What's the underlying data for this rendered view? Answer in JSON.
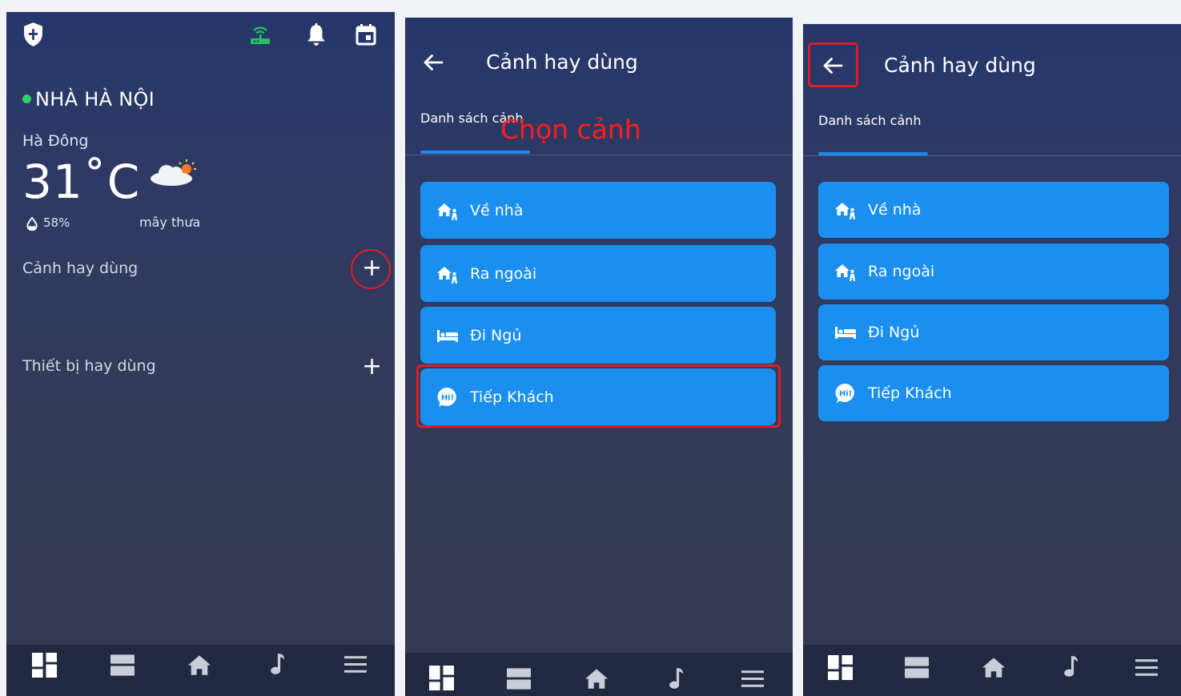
{
  "screen1": {
    "home_name": "NHÀ HÀ NỘI",
    "district": "Hà Đông",
    "temperature": "31˚C",
    "humidity": "58%",
    "weather_desc": "mây thưa",
    "scenes_label": "Cảnh hay dùng",
    "devices_label": "Thiết bị hay dùng",
    "add_symbol": "+",
    "icons": [
      "shield-icon",
      "router-icon",
      "bell-icon",
      "calendar-icon",
      "cloud-sun-icon",
      "droplet-icon",
      "plus-icon"
    ]
  },
  "screen2": {
    "title": "Cảnh hay dùng",
    "tab": "Danh sách cảnh",
    "annotation": "Chọn cảnh",
    "scenes": [
      {
        "label": "Về nhà",
        "icon": "home-person-icon"
      },
      {
        "label": "Ra ngoài",
        "icon": "home-person-icon"
      },
      {
        "label": "Đi Ngủ",
        "icon": "bed-icon"
      },
      {
        "label": "Tiếp Khách",
        "icon": "hi-chat-icon"
      }
    ]
  },
  "screen3": {
    "title": "Cảnh hay dùng",
    "tab": "Danh sách cảnh",
    "scenes": [
      {
        "label": "Về nhà",
        "icon": "home-person-icon"
      },
      {
        "label": "Ra ngoài",
        "icon": "home-person-icon"
      },
      {
        "label": "Đi Ngủ",
        "icon": "bed-icon"
      },
      {
        "label": "Tiếp Khách",
        "icon": "hi-chat-icon"
      }
    ]
  },
  "nav": [
    "dashboard-icon",
    "rooms-icon",
    "home-icon",
    "music-icon",
    "menu-icon"
  ],
  "colors": {
    "accent": "#1a8ff0",
    "annotation": "#e21b23",
    "online": "#2fd16a",
    "router": "#22c55e"
  }
}
